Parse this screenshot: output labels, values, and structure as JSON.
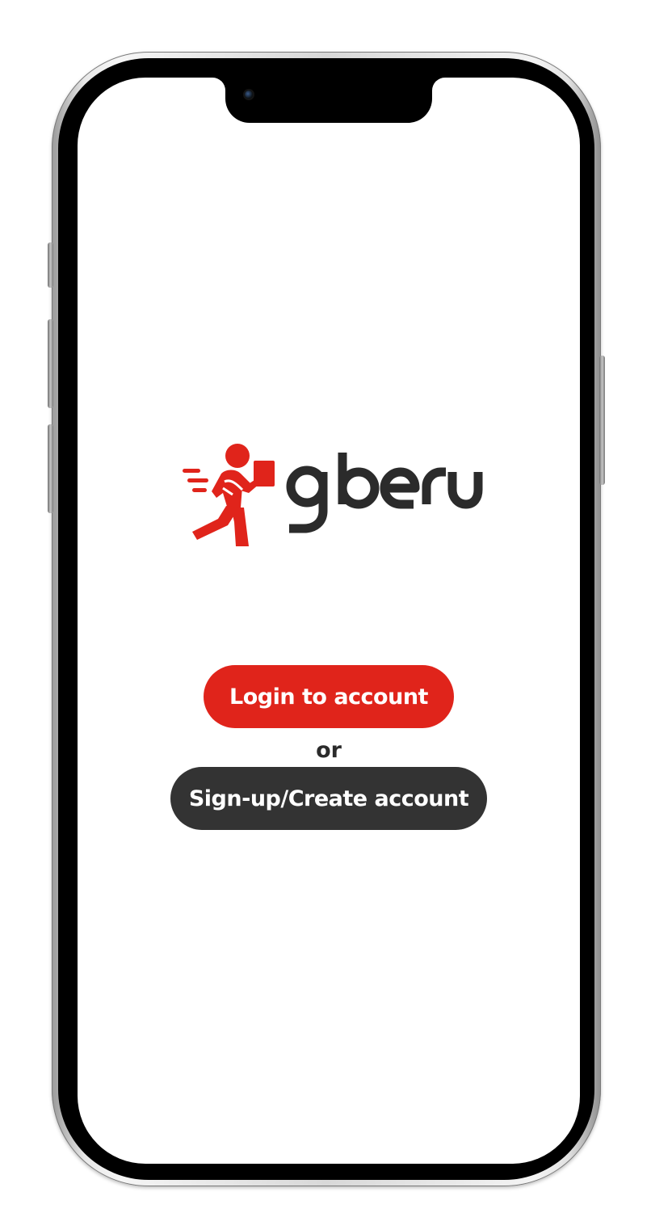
{
  "brand": {
    "name": "gberu",
    "primary_color": "#e0241b",
    "dark_color": "#333333",
    "logo_icon": "delivery-runner-icon"
  },
  "actions": {
    "login_label": "Login to account",
    "separator": "or",
    "signup_label": "Sign-up/Create account"
  }
}
